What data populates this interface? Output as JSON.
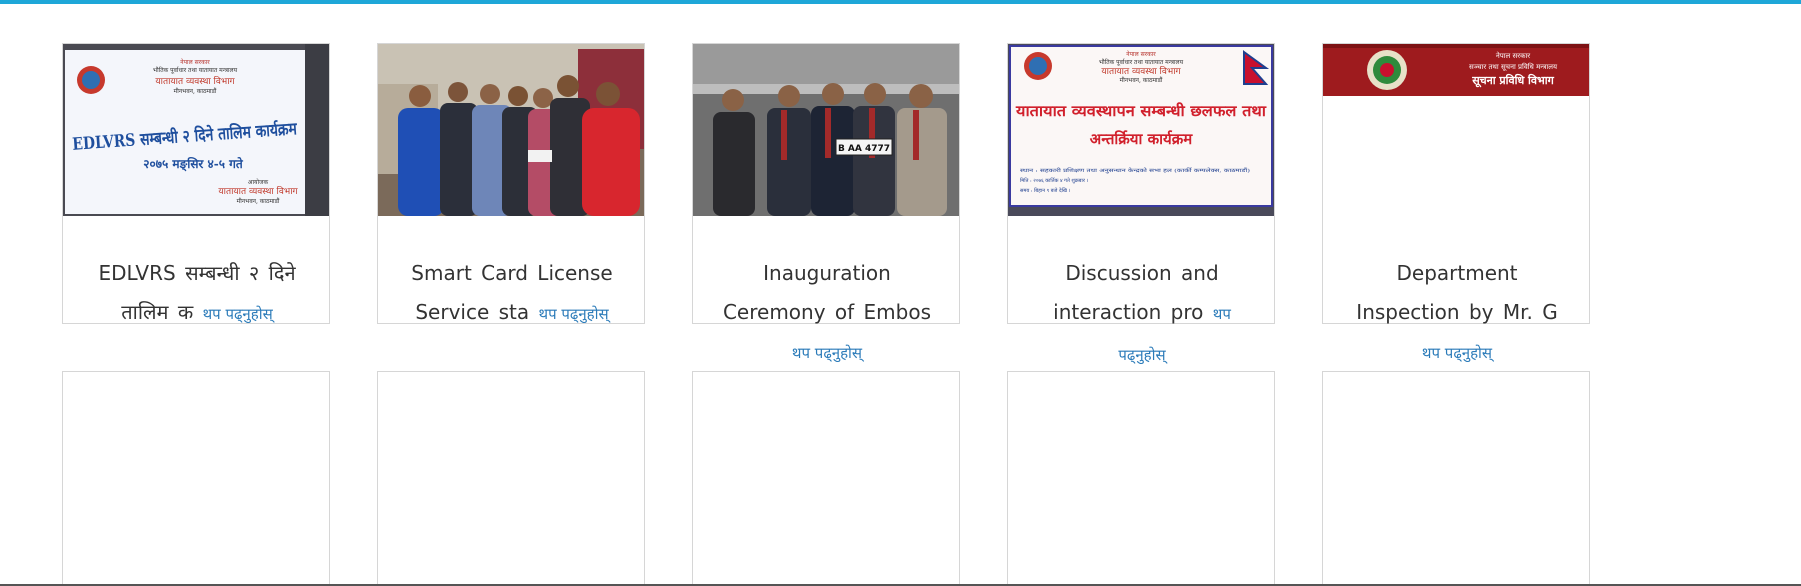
{
  "news": {
    "read_more_label": "थप पढ्नुहोस्",
    "items": [
      {
        "title": "EDLVRS सम्बन्धी २ दिने तालिम क",
        "image": {
          "kind": "banner",
          "line1": "नेपाल सरकार",
          "line2": "भौतिक पूर्वाधार तथा यातायात मन्त्रालय",
          "line3": "यातायात व्यवस्था विभाग",
          "line4": "मीनभवन, काठमाडौं",
          "headline": "EDLVRS सम्बन्धी २ दिने तालिम कार्यक्रम",
          "date": "२०७५ मङ्सिर ४-५ गते",
          "org_label": "आयोजक",
          "org": "यातायात व्यवस्था विभाग",
          "org_place": "मीनभवन, काठमाडौं"
        }
      },
      {
        "title": "Smart Card License Service sta",
        "image": {
          "kind": "photo-group"
        }
      },
      {
        "title": "Inauguration Ceremony of Embos",
        "image": {
          "kind": "photo-ceremony",
          "plate_text": "B AA 4777"
        }
      },
      {
        "title": "Discussion and interaction pro",
        "image": {
          "kind": "banner-red",
          "line1": "नेपाल सरकार",
          "line2": "भौतिक पूर्वाधार तथा यातायात मन्त्रालय",
          "line3": "यातायात व्यवस्था विभाग",
          "line4": "मीनभवन, काठमाडौं",
          "headline1": "यातायात व्यवस्थापन सम्बन्धी छलफल तथा",
          "headline2": "अन्तर्क्रिया कार्यक्रम",
          "detail1": "स्थान : सहकारी प्रशिक्षण तथा अनुसन्धान केन्द्रको सभा हल (कार्की कम्पलेक्स, काठमाडौं)",
          "detail2": "मिति : २०७६ कार्तिक ४ गते शुक्रबार ।",
          "detail3": "समय : बिहान ९ बजे देखि ।"
        }
      },
      {
        "title": "Department Inspection by Mr. G",
        "image": {
          "kind": "header-strip",
          "line1": "नेपाल सरकार",
          "line2": "सञ्चार तथा सूचना प्रविधि मन्त्रालय",
          "line3": "सूचना प्रविधि विभाग"
        }
      }
    ],
    "empty_slots": 5
  },
  "colors": {
    "accent": "#1ea7d8",
    "link": "#2b7bb9",
    "text": "#333333",
    "border": "#d6d6d6"
  }
}
